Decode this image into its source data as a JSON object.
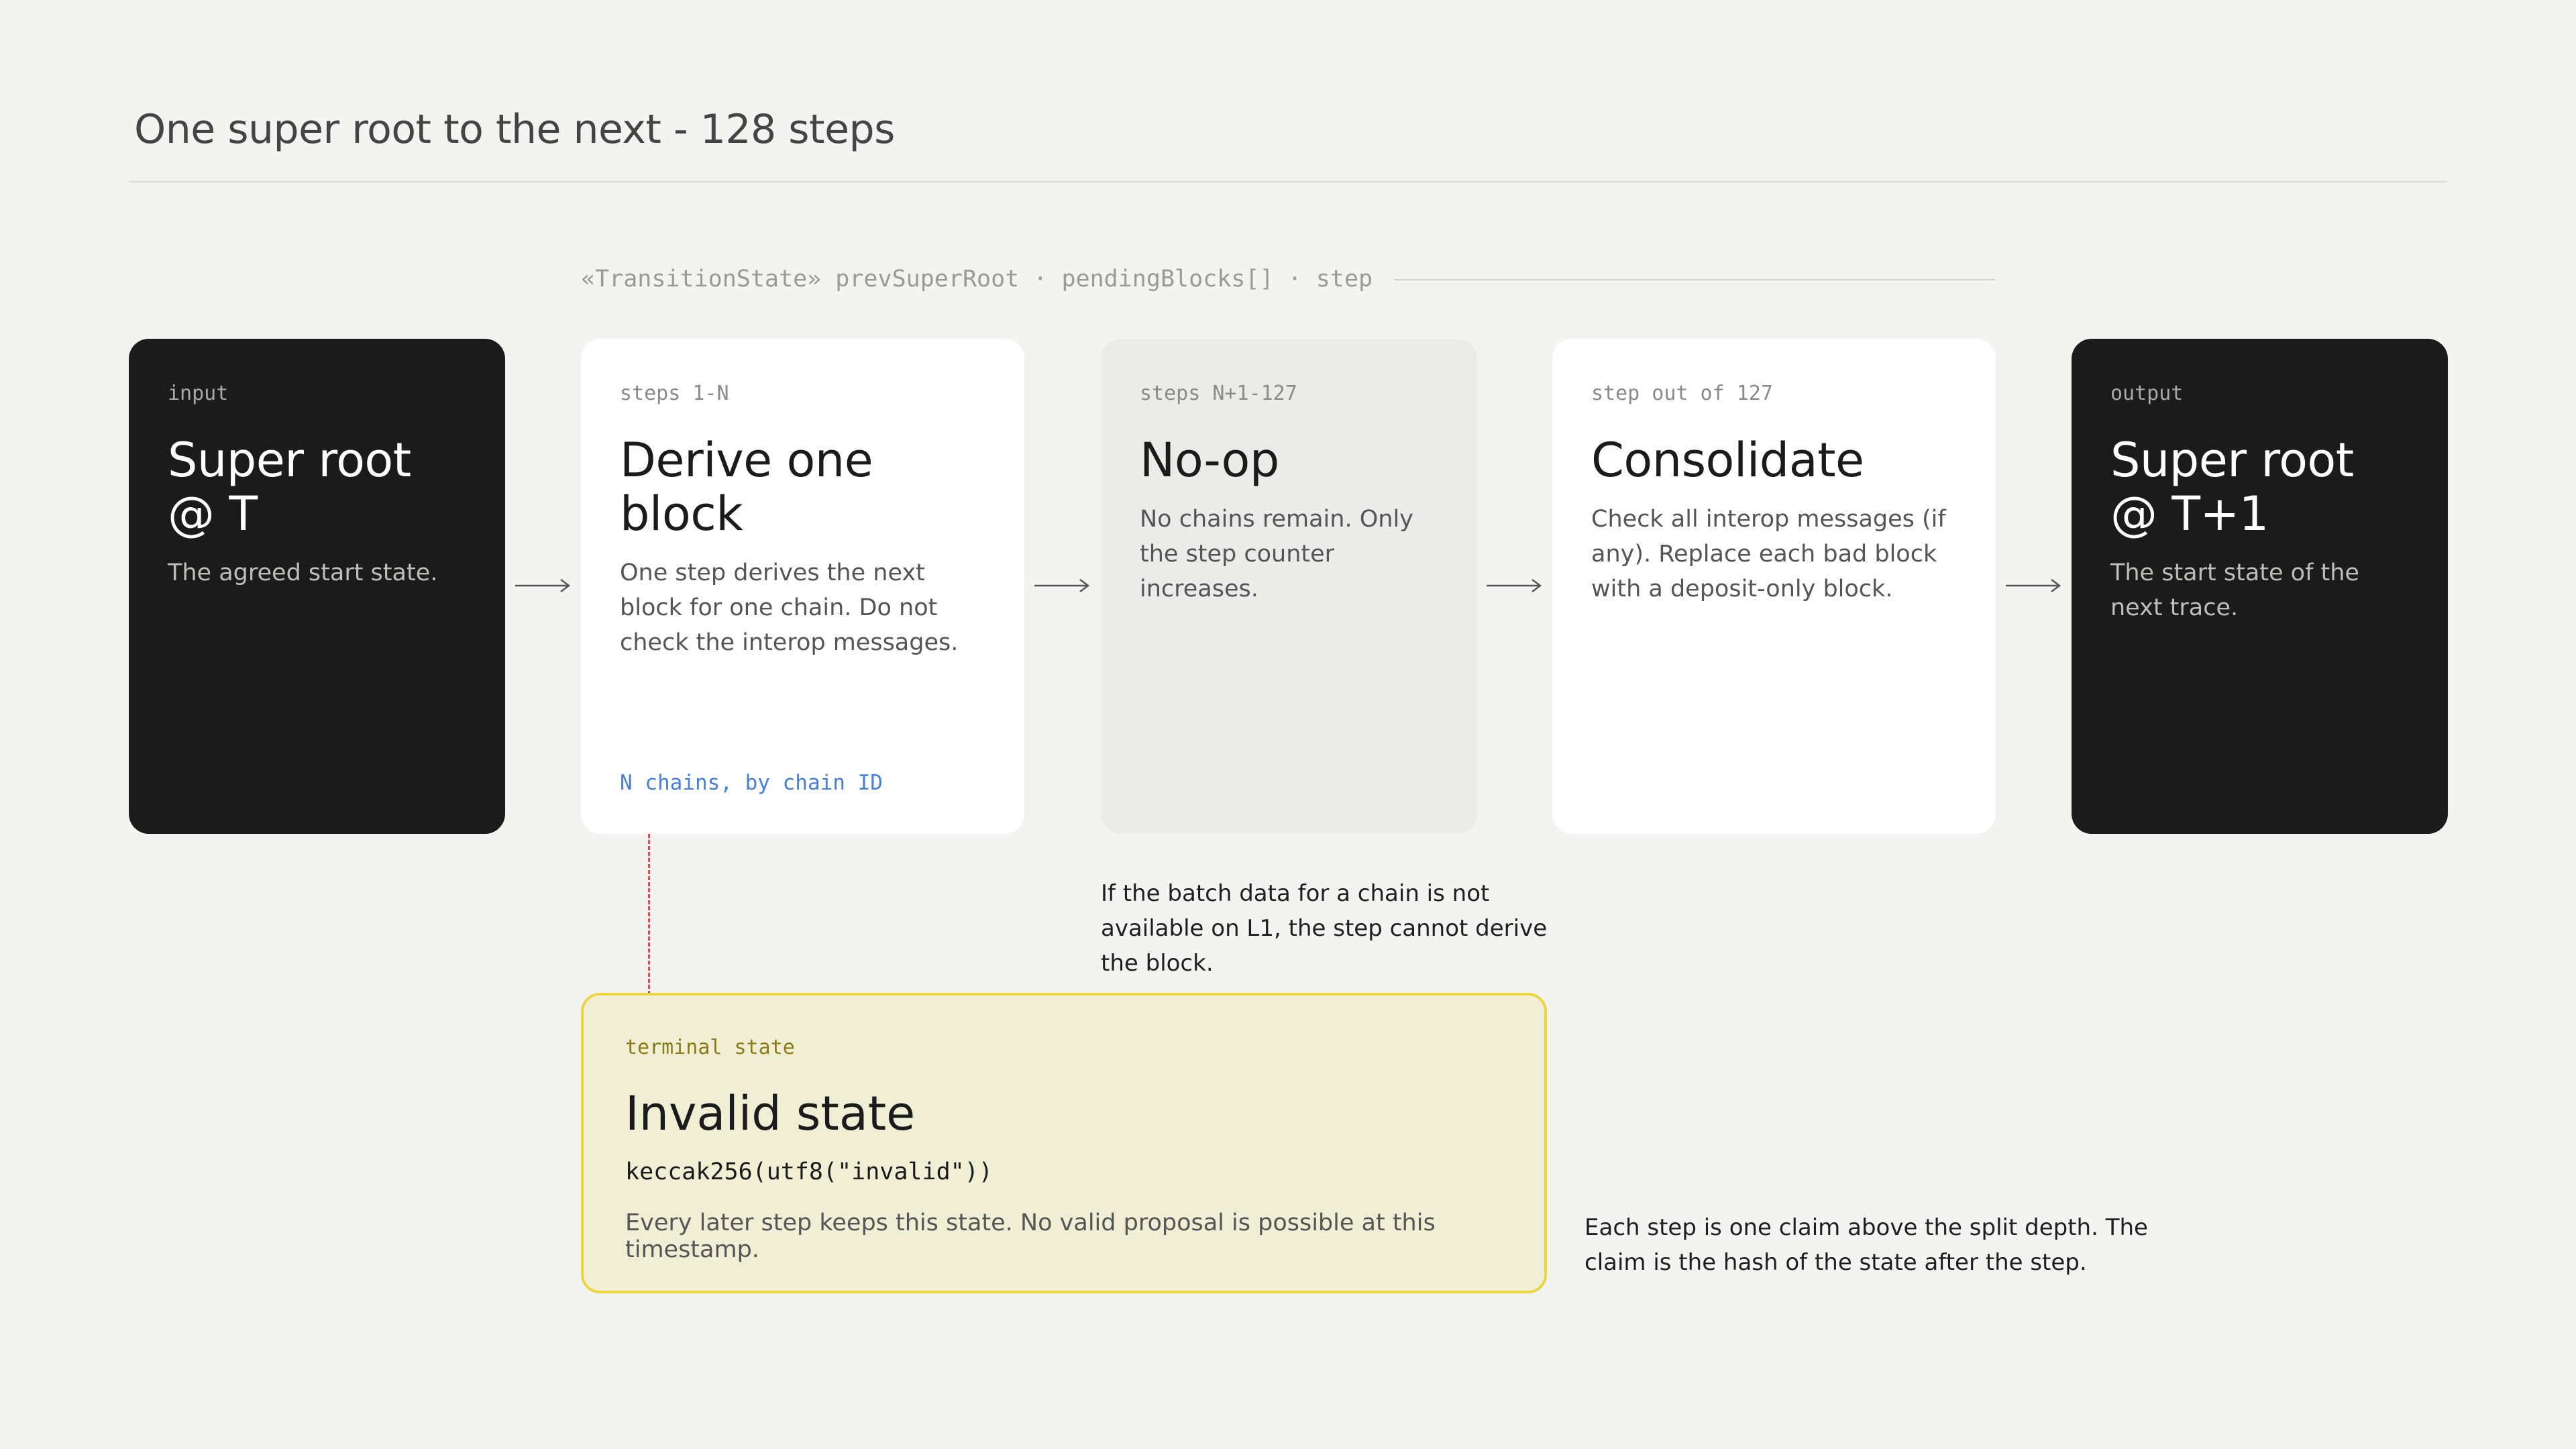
{
  "title": "One super root to the next - 128 steps",
  "state_fields": "«TransitionState»  prevSuperRoot · pendingBlocks[] · step",
  "cards": [
    {
      "kicker": "input",
      "heading": "Super root @ T",
      "desc": "The agreed start state."
    },
    {
      "kicker": "steps 1-N",
      "heading": "Derive one block",
      "desc": "One step derives the next block for one chain. Do not check the interop messages.",
      "foot": "N chains, by chain ID"
    },
    {
      "kicker": "steps N+1-127",
      "heading": "No-op",
      "desc": "No chains remain. Only the step counter increases."
    },
    {
      "kicker": "step out of 127",
      "heading": "Consolidate",
      "desc": "Check all interop messages (if any). Replace each bad block with a deposit-only block."
    },
    {
      "kicker": "output",
      "heading": "Super root @ T+1",
      "desc": "The start state of the next trace."
    }
  ],
  "notes": {
    "batch": "If the batch data for a chain is not available on L1, the step cannot derive the block.",
    "claim": "Each step is one claim above the split depth. The claim is the hash of the state after the step."
  },
  "terminal": {
    "kicker": "terminal state",
    "heading": "Invalid state",
    "code": "keccak256(utf8(\"invalid\"))",
    "desc": "Every later step keeps this state. No valid proposal is possible at this timestamp."
  },
  "colors": {
    "dark_card": "#1b1b1b",
    "accent_blue": "#4a7fd6",
    "terminal_fill": "#f0efd6",
    "terminal_border": "#ecd640",
    "dashed_red": "#e0484e"
  }
}
